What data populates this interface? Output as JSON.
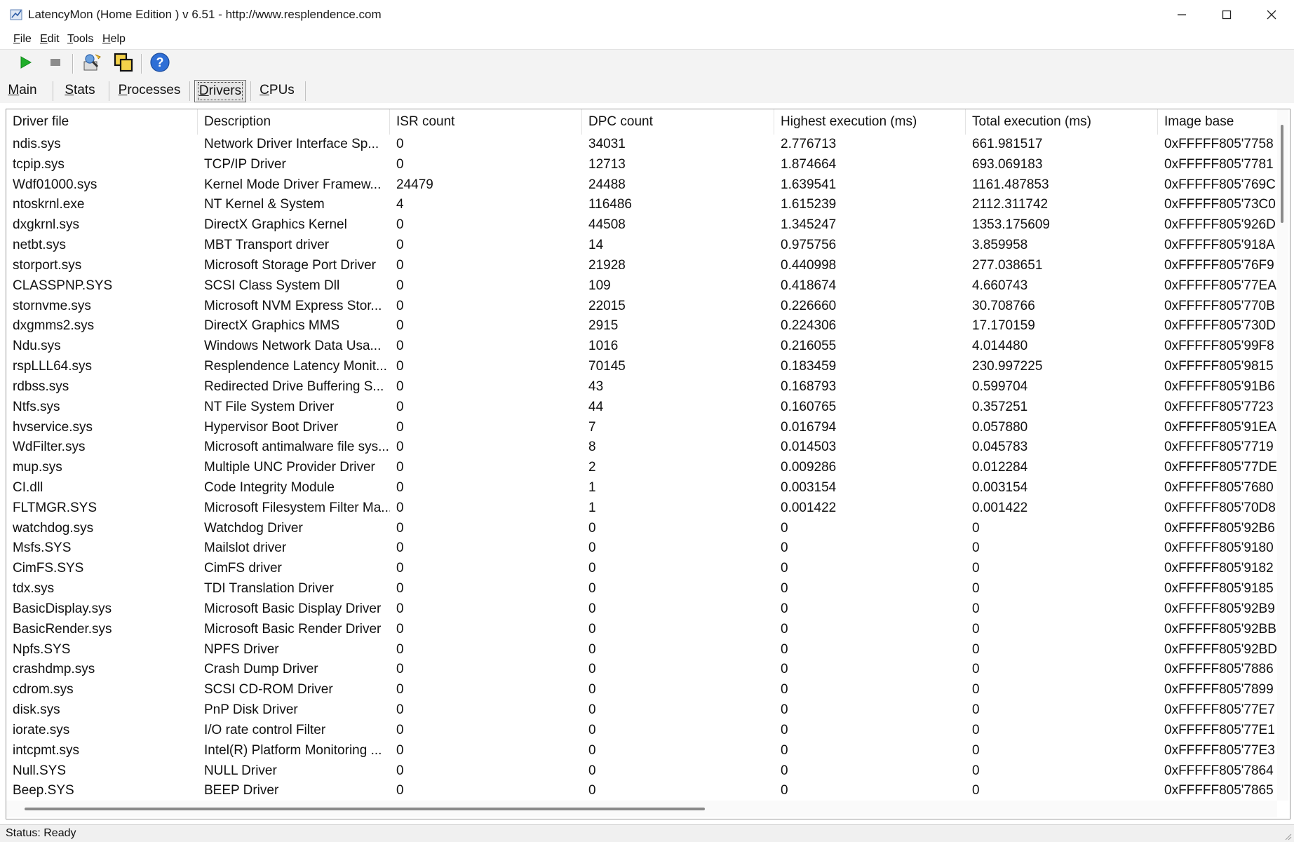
{
  "window": {
    "title": "LatencyMon  (Home Edition )  v 6.51 - http://www.resplendence.com"
  },
  "menu": [
    {
      "accel": "F",
      "rest": "ile"
    },
    {
      "accel": "E",
      "rest": "dit"
    },
    {
      "accel": "T",
      "rest": "ools"
    },
    {
      "accel": "H",
      "rest": "elp"
    }
  ],
  "toolbar": {
    "icons": [
      "play-icon",
      "stop-icon",
      "report-icon",
      "copy-icon",
      "help-icon"
    ],
    "colors": {
      "play": "#1fae2a",
      "stop": "#8c8c8c",
      "help": "#2f6fd6"
    }
  },
  "tabs": [
    {
      "accel": "M",
      "rest": "ain"
    },
    {
      "accel": "S",
      "rest": "tats"
    },
    {
      "accel": "P",
      "rest": "rocesses"
    },
    {
      "accel": "D",
      "rest": "rivers",
      "active": true
    },
    {
      "accel": "C",
      "rest": "PUs"
    }
  ],
  "table": {
    "columns": [
      "Driver file",
      "Description",
      "ISR count",
      "DPC count",
      "Highest execution (ms)",
      "Total execution (ms)",
      "Image base"
    ],
    "rows": [
      [
        "ndis.sys",
        "Network Driver Interface Sp...",
        "0",
        "34031",
        "2.776713",
        "661.981517",
        "0xFFFFF805'7758"
      ],
      [
        "tcpip.sys",
        "TCP/IP Driver",
        "0",
        "12713",
        "1.874664",
        "693.069183",
        "0xFFFFF805'7781"
      ],
      [
        "Wdf01000.sys",
        "Kernel Mode Driver Framew...",
        "24479",
        "24488",
        "1.639541",
        "1161.487853",
        "0xFFFFF805'769C"
      ],
      [
        "ntoskrnl.exe",
        "NT Kernel & System",
        "4",
        "116486",
        "1.615239",
        "2112.311742",
        "0xFFFFF805'73C0"
      ],
      [
        "dxgkrnl.sys",
        "DirectX Graphics Kernel",
        "0",
        "44508",
        "1.345247",
        "1353.175609",
        "0xFFFFF805'926D"
      ],
      [
        "netbt.sys",
        "MBT Transport driver",
        "0",
        "14",
        "0.975756",
        "3.859958",
        "0xFFFFF805'918A"
      ],
      [
        "storport.sys",
        "Microsoft Storage Port Driver",
        "0",
        "21928",
        "0.440998",
        "277.038651",
        "0xFFFFF805'76F9"
      ],
      [
        "CLASSPNP.SYS",
        "SCSI Class System Dll",
        "0",
        "109",
        "0.418674",
        "4.660743",
        "0xFFFFF805'77EA"
      ],
      [
        "stornvme.sys",
        "Microsoft NVM Express Stor...",
        "0",
        "22015",
        "0.226660",
        "30.708766",
        "0xFFFFF805'770B"
      ],
      [
        "dxgmms2.sys",
        "DirectX Graphics MMS",
        "0",
        "2915",
        "0.224306",
        "17.170159",
        "0xFFFFF805'730D"
      ],
      [
        "Ndu.sys",
        "Windows Network Data Usa...",
        "0",
        "1016",
        "0.216055",
        "4.014480",
        "0xFFFFF805'99F8"
      ],
      [
        "rspLLL64.sys",
        "Resplendence Latency Monit...",
        "0",
        "70145",
        "0.183459",
        "230.997225",
        "0xFFFFF805'9815"
      ],
      [
        "rdbss.sys",
        "Redirected Drive Buffering S...",
        "0",
        "43",
        "0.168793",
        "0.599704",
        "0xFFFFF805'91B6"
      ],
      [
        "Ntfs.sys",
        "NT File System Driver",
        "0",
        "44",
        "0.160765",
        "0.357251",
        "0xFFFFF805'7723"
      ],
      [
        "hvservice.sys",
        "Hypervisor Boot Driver",
        "0",
        "7",
        "0.016794",
        "0.057880",
        "0xFFFFF805'91EA"
      ],
      [
        "WdFilter.sys",
        "Microsoft antimalware file sys...",
        "0",
        "8",
        "0.014503",
        "0.045783",
        "0xFFFFF805'7719"
      ],
      [
        "mup.sys",
        "Multiple UNC Provider Driver",
        "0",
        "2",
        "0.009286",
        "0.012284",
        "0xFFFFF805'77DE"
      ],
      [
        "CI.dll",
        "Code Integrity Module",
        "0",
        "1",
        "0.003154",
        "0.003154",
        "0xFFFFF805'7680"
      ],
      [
        "FLTMGR.SYS",
        "Microsoft Filesystem Filter Ma...",
        "0",
        "1",
        "0.001422",
        "0.001422",
        "0xFFFFF805'70D8"
      ],
      [
        "watchdog.sys",
        "Watchdog Driver",
        "0",
        "0",
        "0",
        "0",
        "0xFFFFF805'92B6"
      ],
      [
        "Msfs.SYS",
        "Mailslot driver",
        "0",
        "0",
        "0",
        "0",
        "0xFFFFF805'9180"
      ],
      [
        "CimFS.SYS",
        "CimFS driver",
        "0",
        "0",
        "0",
        "0",
        "0xFFFFF805'9182"
      ],
      [
        "tdx.sys",
        "TDI Translation Driver",
        "0",
        "0",
        "0",
        "0",
        "0xFFFFF805'9185"
      ],
      [
        "BasicDisplay.sys",
        "Microsoft Basic Display Driver",
        "0",
        "0",
        "0",
        "0",
        "0xFFFFF805'92B9"
      ],
      [
        "BasicRender.sys",
        "Microsoft Basic Render Driver",
        "0",
        "0",
        "0",
        "0",
        "0xFFFFF805'92BB"
      ],
      [
        "Npfs.SYS",
        "NPFS Driver",
        "0",
        "0",
        "0",
        "0",
        "0xFFFFF805'92BD"
      ],
      [
        "crashdmp.sys",
        "Crash Dump Driver",
        "0",
        "0",
        "0",
        "0",
        "0xFFFFF805'7886"
      ],
      [
        "cdrom.sys",
        "SCSI CD-ROM Driver",
        "0",
        "0",
        "0",
        "0",
        "0xFFFFF805'7899"
      ],
      [
        "disk.sys",
        "PnP Disk Driver",
        "0",
        "0",
        "0",
        "0",
        "0xFFFFF805'77E7"
      ],
      [
        "iorate.sys",
        "I/O rate control Filter",
        "0",
        "0",
        "0",
        "0",
        "0xFFFFF805'77E1"
      ],
      [
        "intcpmt.sys",
        "Intel(R) Platform Monitoring ...",
        "0",
        "0",
        "0",
        "0",
        "0xFFFFF805'77E3"
      ],
      [
        "Null.SYS",
        "NULL Driver",
        "0",
        "0",
        "0",
        "0",
        "0xFFFFF805'7864"
      ],
      [
        "Beep.SYS",
        "BEEP Driver",
        "0",
        "0",
        "0",
        "0",
        "0xFFFFF805'7865"
      ]
    ]
  },
  "status": {
    "text": "Status: Ready"
  }
}
